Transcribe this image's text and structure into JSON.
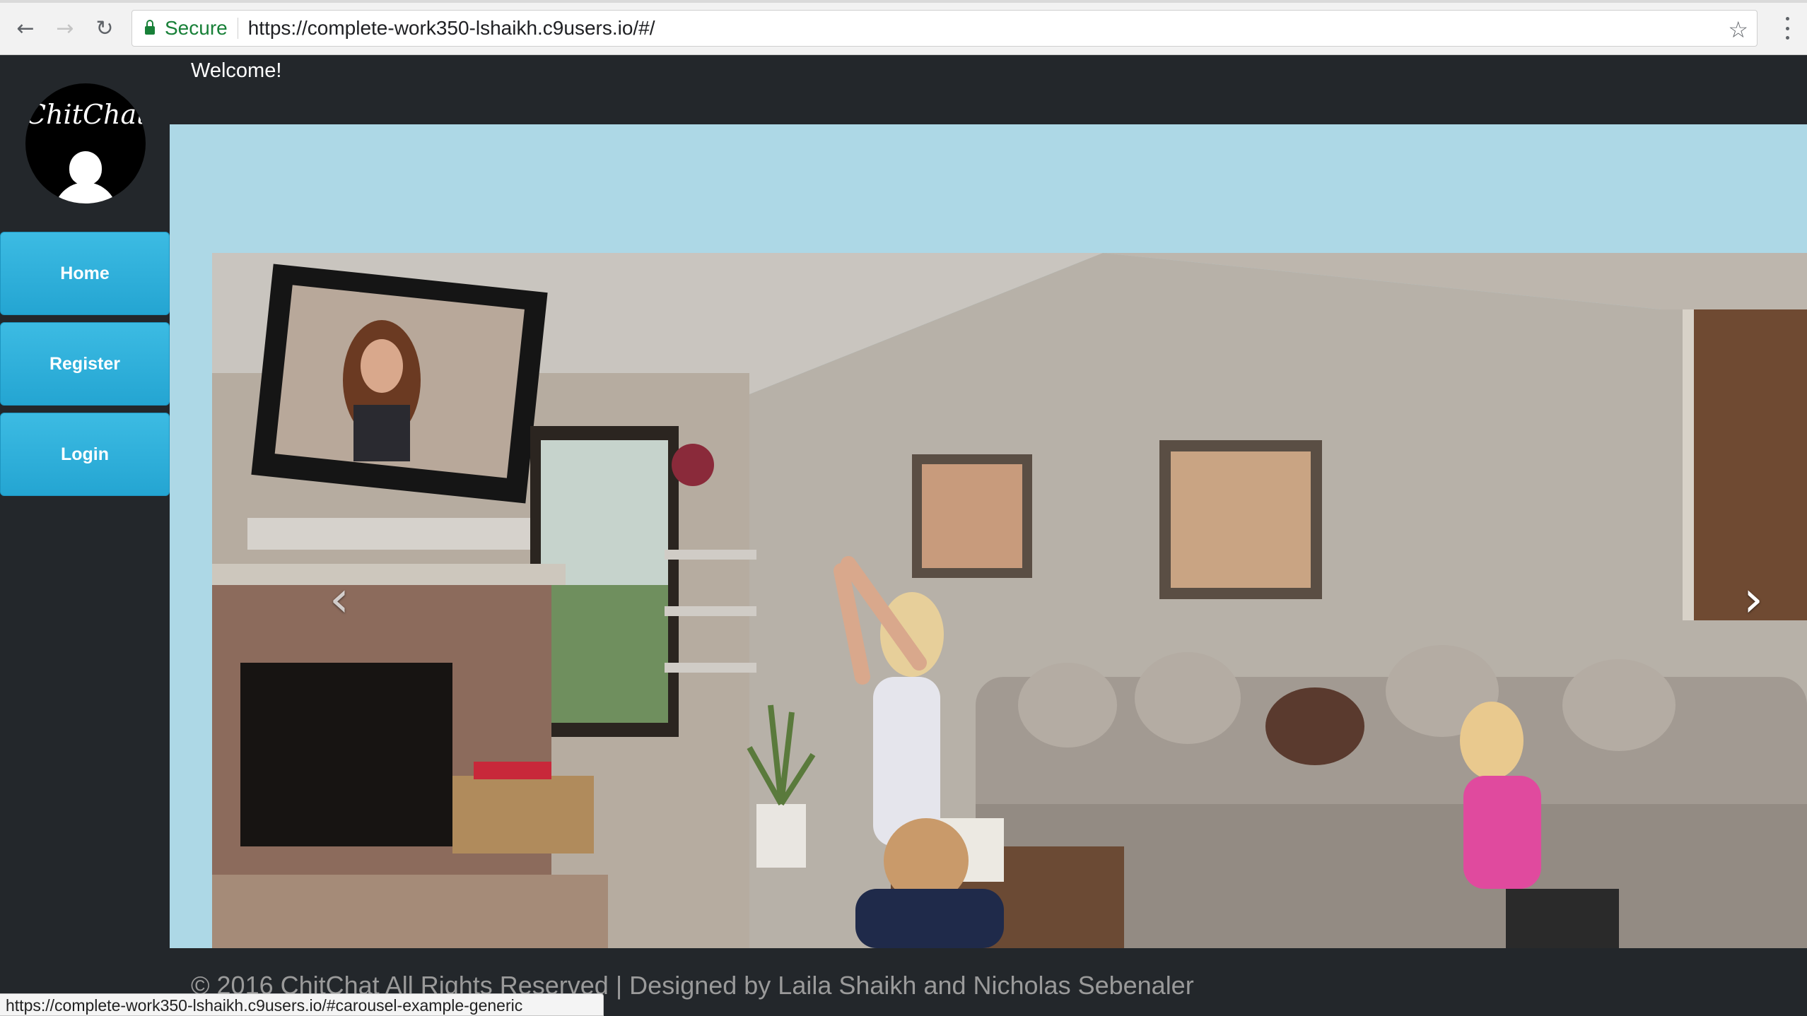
{
  "browser": {
    "secure_label": "Secure",
    "url": "https://complete-work350-lshaikh.c9users.io/#/",
    "status_url": "https://complete-work350-lshaikh.c9users.io/#carousel-example-generic"
  },
  "sidebar": {
    "logo_text": "ChitChat",
    "items": [
      {
        "label": "Home"
      },
      {
        "label": "Register"
      },
      {
        "label": "Login"
      }
    ]
  },
  "header": {
    "welcome": "Welcome!"
  },
  "carousel": {
    "prev_glyph": "‹",
    "next_glyph": "›"
  },
  "footer": {
    "text": "© 2016 ChitChat All Rights Reserved | Designed by Laila Shaikh and Nicholas Sebenaler"
  },
  "colors": {
    "sidebar_bg": "#23272b",
    "nav_button": "#2aaed9",
    "content_bg": "#add8e6",
    "secure_green": "#188038"
  }
}
